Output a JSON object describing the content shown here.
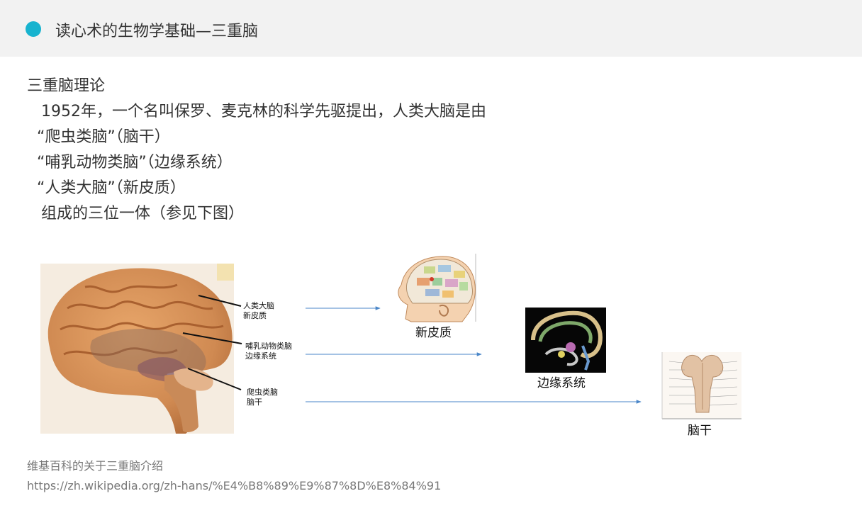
{
  "header": {
    "title": "读心术的生物学基础—三重脑"
  },
  "content": {
    "lines": [
      "三重脑理论",
      "1952年，一个名叫保罗、麦克林的科学先驱提出，人类大脑是由",
      "“爬虫类脑”（脑干）",
      "“哺乳动物类脑”（边缘系统）",
      "“人类大脑”（新皮质）",
      "组成的三位一体（参见下图）"
    ]
  },
  "figure": {
    "labels": [
      {
        "line1": "人类大脑",
        "line2": "新皮质"
      },
      {
        "line1": "哺乳动物类脑",
        "line2": "边缘系统"
      },
      {
        "line1": "爬虫类脑",
        "line2": "脑干"
      }
    ],
    "captions": {
      "neocortex": "新皮质",
      "limbic": "边缘系统",
      "brainstem": "脑干"
    },
    "colors": {
      "arrow": "#4a86c8",
      "brain_main": "#d9935a",
      "limbic_shade": "#8a6a5a"
    }
  },
  "source": {
    "title": "维基百科的关于三重脑介绍",
    "url": "https://zh.wikipedia.org/zh-hans/%E4%B8%89%E9%87%8D%E8%84%91"
  }
}
